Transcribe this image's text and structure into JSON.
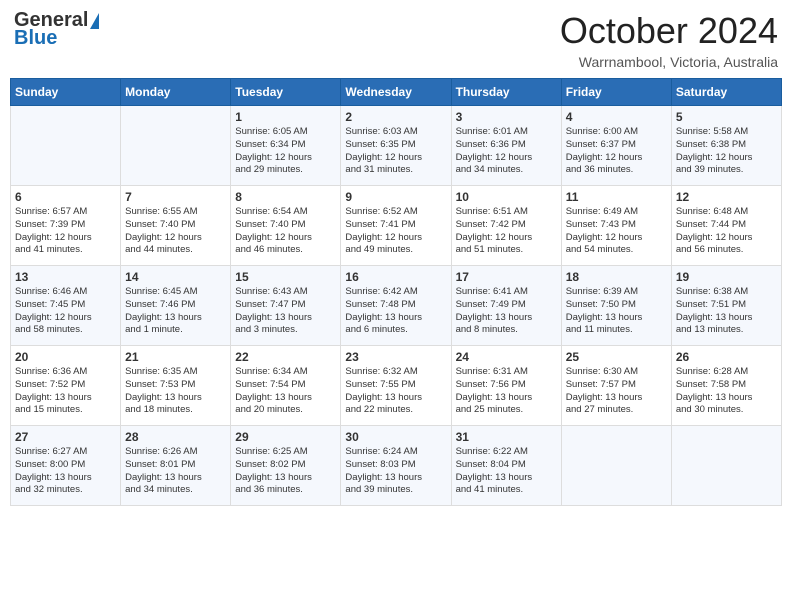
{
  "header": {
    "logo_general": "General",
    "logo_blue": "Blue",
    "month": "October 2024",
    "location": "Warrnambool, Victoria, Australia"
  },
  "days_of_week": [
    "Sunday",
    "Monday",
    "Tuesday",
    "Wednesday",
    "Thursday",
    "Friday",
    "Saturday"
  ],
  "weeks": [
    [
      {
        "day": "",
        "info": ""
      },
      {
        "day": "",
        "info": ""
      },
      {
        "day": "1",
        "info": "Sunrise: 6:05 AM\nSunset: 6:34 PM\nDaylight: 12 hours\nand 29 minutes."
      },
      {
        "day": "2",
        "info": "Sunrise: 6:03 AM\nSunset: 6:35 PM\nDaylight: 12 hours\nand 31 minutes."
      },
      {
        "day": "3",
        "info": "Sunrise: 6:01 AM\nSunset: 6:36 PM\nDaylight: 12 hours\nand 34 minutes."
      },
      {
        "day": "4",
        "info": "Sunrise: 6:00 AM\nSunset: 6:37 PM\nDaylight: 12 hours\nand 36 minutes."
      },
      {
        "day": "5",
        "info": "Sunrise: 5:58 AM\nSunset: 6:38 PM\nDaylight: 12 hours\nand 39 minutes."
      }
    ],
    [
      {
        "day": "6",
        "info": "Sunrise: 6:57 AM\nSunset: 7:39 PM\nDaylight: 12 hours\nand 41 minutes."
      },
      {
        "day": "7",
        "info": "Sunrise: 6:55 AM\nSunset: 7:40 PM\nDaylight: 12 hours\nand 44 minutes."
      },
      {
        "day": "8",
        "info": "Sunrise: 6:54 AM\nSunset: 7:40 PM\nDaylight: 12 hours\nand 46 minutes."
      },
      {
        "day": "9",
        "info": "Sunrise: 6:52 AM\nSunset: 7:41 PM\nDaylight: 12 hours\nand 49 minutes."
      },
      {
        "day": "10",
        "info": "Sunrise: 6:51 AM\nSunset: 7:42 PM\nDaylight: 12 hours\nand 51 minutes."
      },
      {
        "day": "11",
        "info": "Sunrise: 6:49 AM\nSunset: 7:43 PM\nDaylight: 12 hours\nand 54 minutes."
      },
      {
        "day": "12",
        "info": "Sunrise: 6:48 AM\nSunset: 7:44 PM\nDaylight: 12 hours\nand 56 minutes."
      }
    ],
    [
      {
        "day": "13",
        "info": "Sunrise: 6:46 AM\nSunset: 7:45 PM\nDaylight: 12 hours\nand 58 minutes."
      },
      {
        "day": "14",
        "info": "Sunrise: 6:45 AM\nSunset: 7:46 PM\nDaylight: 13 hours\nand 1 minute."
      },
      {
        "day": "15",
        "info": "Sunrise: 6:43 AM\nSunset: 7:47 PM\nDaylight: 13 hours\nand 3 minutes."
      },
      {
        "day": "16",
        "info": "Sunrise: 6:42 AM\nSunset: 7:48 PM\nDaylight: 13 hours\nand 6 minutes."
      },
      {
        "day": "17",
        "info": "Sunrise: 6:41 AM\nSunset: 7:49 PM\nDaylight: 13 hours\nand 8 minutes."
      },
      {
        "day": "18",
        "info": "Sunrise: 6:39 AM\nSunset: 7:50 PM\nDaylight: 13 hours\nand 11 minutes."
      },
      {
        "day": "19",
        "info": "Sunrise: 6:38 AM\nSunset: 7:51 PM\nDaylight: 13 hours\nand 13 minutes."
      }
    ],
    [
      {
        "day": "20",
        "info": "Sunrise: 6:36 AM\nSunset: 7:52 PM\nDaylight: 13 hours\nand 15 minutes."
      },
      {
        "day": "21",
        "info": "Sunrise: 6:35 AM\nSunset: 7:53 PM\nDaylight: 13 hours\nand 18 minutes."
      },
      {
        "day": "22",
        "info": "Sunrise: 6:34 AM\nSunset: 7:54 PM\nDaylight: 13 hours\nand 20 minutes."
      },
      {
        "day": "23",
        "info": "Sunrise: 6:32 AM\nSunset: 7:55 PM\nDaylight: 13 hours\nand 22 minutes."
      },
      {
        "day": "24",
        "info": "Sunrise: 6:31 AM\nSunset: 7:56 PM\nDaylight: 13 hours\nand 25 minutes."
      },
      {
        "day": "25",
        "info": "Sunrise: 6:30 AM\nSunset: 7:57 PM\nDaylight: 13 hours\nand 27 minutes."
      },
      {
        "day": "26",
        "info": "Sunrise: 6:28 AM\nSunset: 7:58 PM\nDaylight: 13 hours\nand 30 minutes."
      }
    ],
    [
      {
        "day": "27",
        "info": "Sunrise: 6:27 AM\nSunset: 8:00 PM\nDaylight: 13 hours\nand 32 minutes."
      },
      {
        "day": "28",
        "info": "Sunrise: 6:26 AM\nSunset: 8:01 PM\nDaylight: 13 hours\nand 34 minutes."
      },
      {
        "day": "29",
        "info": "Sunrise: 6:25 AM\nSunset: 8:02 PM\nDaylight: 13 hours\nand 36 minutes."
      },
      {
        "day": "30",
        "info": "Sunrise: 6:24 AM\nSunset: 8:03 PM\nDaylight: 13 hours\nand 39 minutes."
      },
      {
        "day": "31",
        "info": "Sunrise: 6:22 AM\nSunset: 8:04 PM\nDaylight: 13 hours\nand 41 minutes."
      },
      {
        "day": "",
        "info": ""
      },
      {
        "day": "",
        "info": ""
      }
    ]
  ]
}
